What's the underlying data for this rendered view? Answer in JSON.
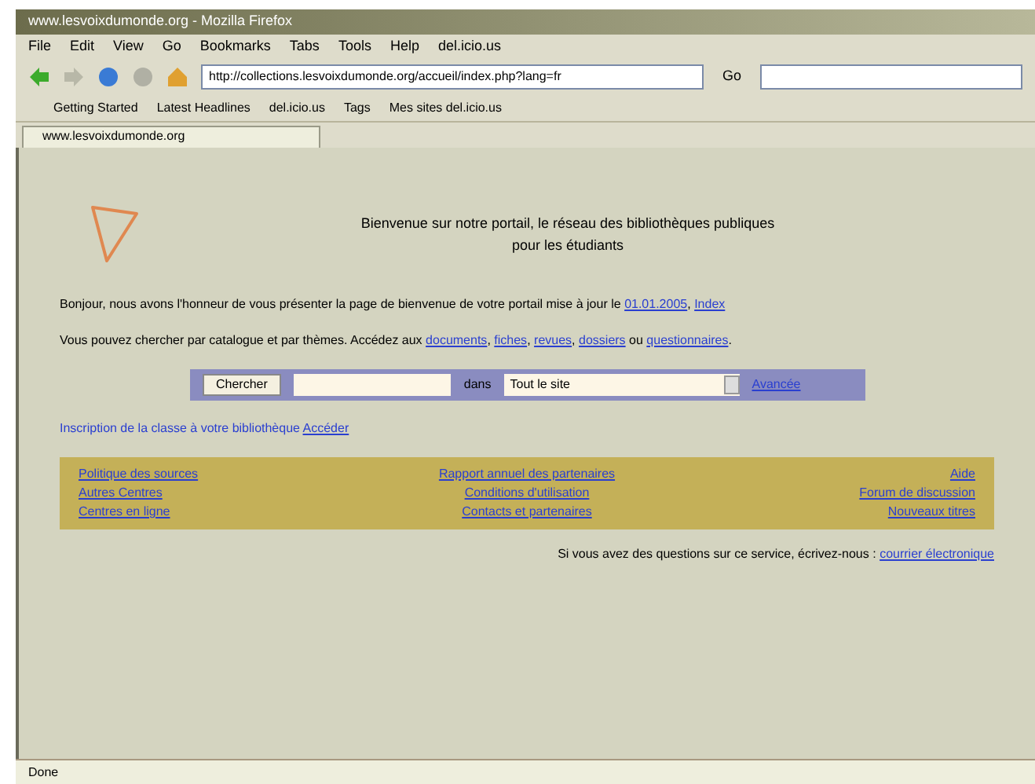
{
  "window": {
    "title": "www.lesvoixdumonde.org - Mozilla Firefox"
  },
  "menu": [
    "File",
    "Edit",
    "View",
    "Go",
    "Bookmarks",
    "Tabs",
    "Tools",
    "Help",
    "del.icio.us"
  ],
  "toolbar": {
    "url": "http://collections.lesvoixdumonde.org/accueil/index.php?lang=fr",
    "go": "Go"
  },
  "bookmarks": [
    "Getting Started",
    "Latest Headlines",
    "del.icio.us",
    "Tags",
    "Mes sites del.icio.us"
  ],
  "tabs": [
    {
      "label": "www.lesvoixdumonde.org",
      "selected": true
    }
  ],
  "page": {
    "heading": "Bienvenue sur notre portail, le réseau des bibliothèques publiques",
    "subheading": "pour les étudiants",
    "intro": "Bonjour, nous avons l'honneur de vous présenter la page de bienvenue de votre portail mise à jour le",
    "intro_links": [
      {
        "text": "01.01.2005",
        "after": ","
      },
      {
        "text": "Index"
      }
    ],
    "info": "Vous pouvez chercher par catalogue et par thèmes. Accédez aux",
    "info_links": [
      {
        "text": "documents",
        "after": ","
      },
      {
        "text": "fiches",
        "after": ","
      },
      {
        "text": "revues",
        "after": ","
      },
      {
        "text": "dossiers"
      },
      {
        "text": "questionnaires",
        "after": "."
      }
    ],
    "info_joiner": "ou",
    "search": {
      "button": "Chercher",
      "label": "dans",
      "select": "Tout le site",
      "link": "Avancée"
    },
    "notice": "Inscription de la classe à votre bibliothèque",
    "notice_link": "Accéder",
    "nav": [
      [
        "Politique des sources",
        "Rapport annuel des partenaires",
        "Aide"
      ],
      [
        "Autres Centres",
        "Conditions d'utilisation",
        "Forum de discussion"
      ],
      [
        "Centres en ligne",
        "Contacts et partenaires",
        "Nouveaux titres"
      ]
    ],
    "footer": "Si vous avez des questions sur ce service, écrivez-nous :",
    "footer_link": "courrier électronique"
  },
  "status_bar": "Done"
}
